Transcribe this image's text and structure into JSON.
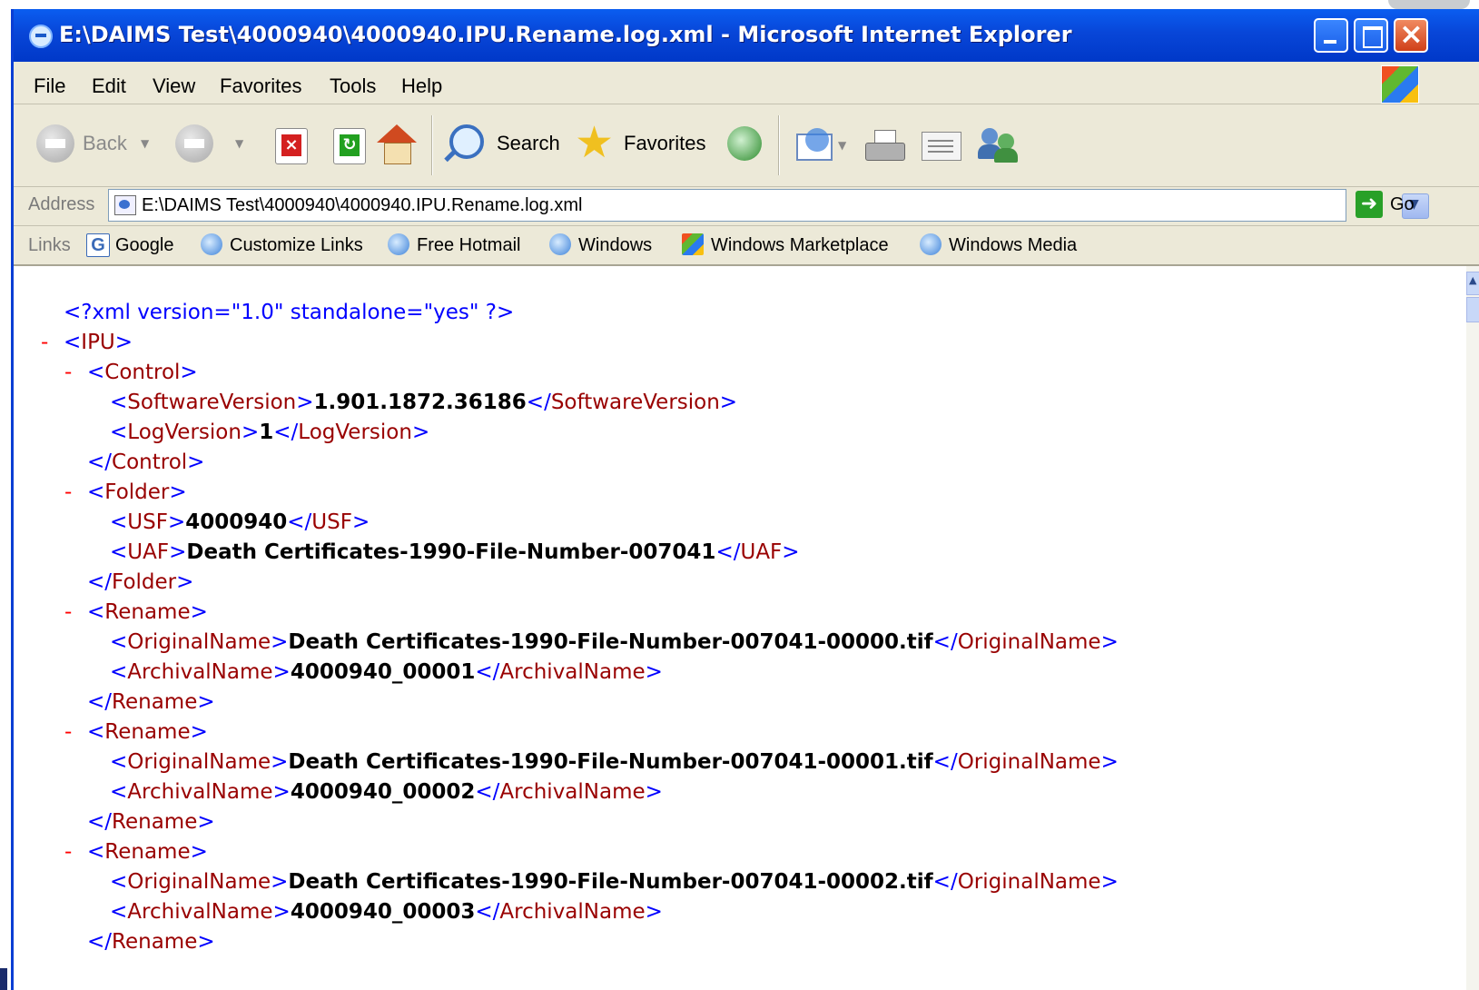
{
  "window": {
    "title": "E:\\DAIMS Test\\4000940\\4000940.IPU.Rename.log.xml - Microsoft Internet Explorer"
  },
  "menu": [
    "File",
    "Edit",
    "View",
    "Favorites",
    "Tools",
    "Help"
  ],
  "toolbar": {
    "back_label": "Back",
    "search_label": "Search",
    "favorites_label": "Favorites",
    "icons": [
      "back-icon",
      "forward-icon",
      "stop-icon",
      "refresh-icon",
      "home-icon",
      "search-icon",
      "favorites-icon",
      "history-icon",
      "mail-icon",
      "print-icon",
      "edit-icon",
      "discuss-icon"
    ]
  },
  "address": {
    "label": "Address",
    "value": "E:\\DAIMS Test\\4000940\\4000940.IPU.Rename.log.xml",
    "go_label": "Go"
  },
  "links": {
    "label": "Links",
    "items": [
      "Google",
      "Customize Links",
      "Free Hotmail",
      "Windows",
      "Windows Marketplace",
      "Windows Media"
    ]
  },
  "xml": {
    "declaration": "<?xml version=\"1.0\" standalone=\"yes\" ?>",
    "root_tag": "IPU",
    "control": {
      "tag": "Control",
      "software_version_tag": "SoftwareVersion",
      "software_version": "1.901.1872.36186",
      "log_version_tag": "LogVersion",
      "log_version": "1"
    },
    "folder": {
      "tag": "Folder",
      "usf_tag": "USF",
      "usf": "4000940",
      "uaf_tag": "UAF",
      "uaf": "Death Certificates-1990-File-Number-007041"
    },
    "rename_tag": "Rename",
    "original_tag": "OriginalName",
    "archival_tag": "ArchivalName",
    "renames": [
      {
        "original": "Death Certificates-1990-File-Number-007041-00000.tif",
        "archival": "4000940_00001"
      },
      {
        "original": "Death Certificates-1990-File-Number-007041-00001.tif",
        "archival": "4000940_00002"
      },
      {
        "original": "Death Certificates-1990-File-Number-007041-00002.tif",
        "archival": "4000940_00003"
      }
    ]
  },
  "colors": {
    "markup": "#0000ff",
    "tag_name": "#990000",
    "collapse_minus": "#ff0000",
    "titlebar": "#0846d8"
  }
}
